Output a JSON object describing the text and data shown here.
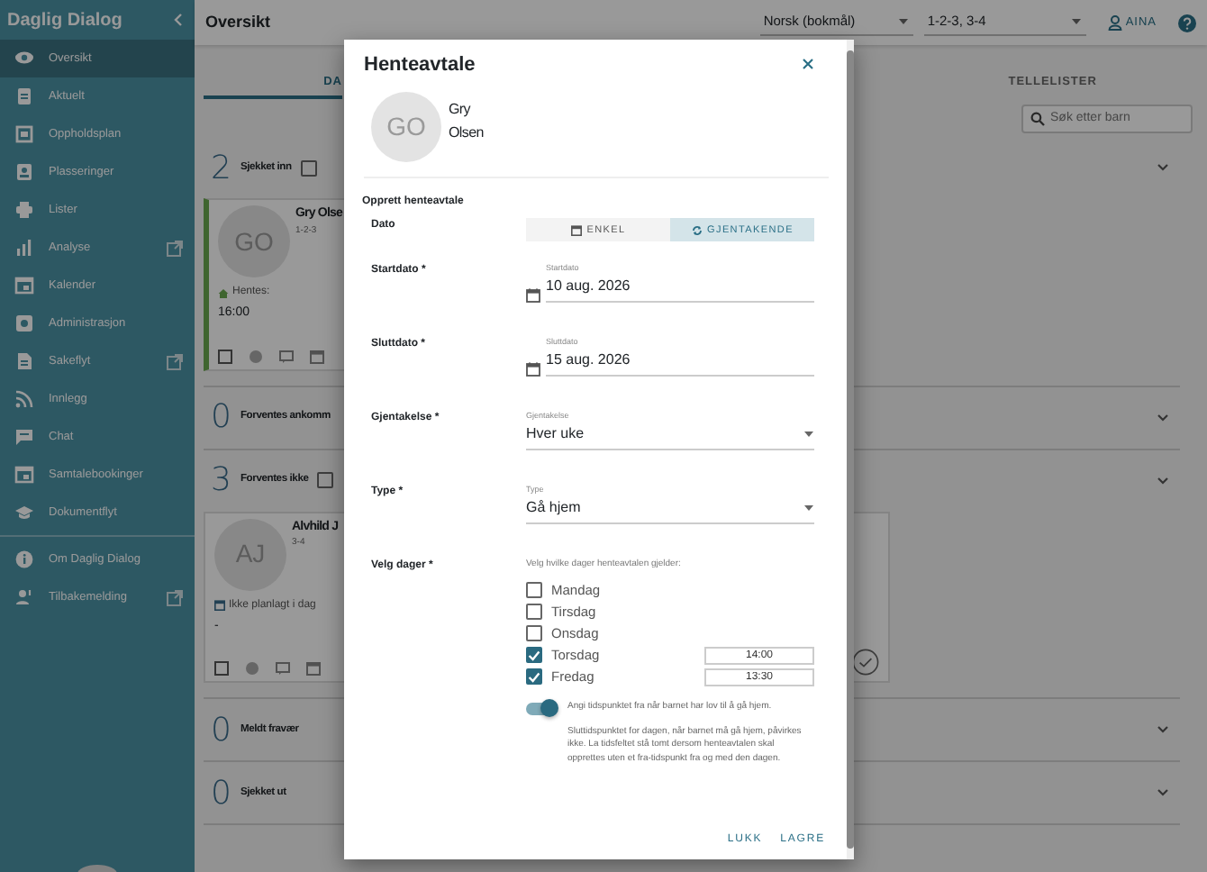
{
  "sidebar": {
    "title": "Daglig Dialog",
    "items": [
      {
        "label": "Oversikt",
        "selected": true,
        "external": false
      },
      {
        "label": "Aktuelt",
        "selected": false,
        "external": false
      },
      {
        "label": "Oppholdsplan",
        "selected": false,
        "external": false
      },
      {
        "label": "Plasseringer",
        "selected": false,
        "external": false
      },
      {
        "label": "Lister",
        "selected": false,
        "external": false
      },
      {
        "label": "Analyse",
        "selected": false,
        "external": true
      },
      {
        "label": "Kalender",
        "selected": false,
        "external": false
      },
      {
        "label": "Administrasjon",
        "selected": false,
        "external": false
      },
      {
        "label": "Sakeflyt",
        "selected": false,
        "external": true
      },
      {
        "label": "Innlegg",
        "selected": false,
        "external": false
      },
      {
        "label": "Chat",
        "selected": false,
        "external": false
      },
      {
        "label": "Samtalebookinger",
        "selected": false,
        "external": false
      },
      {
        "label": "Dokumentflyt",
        "selected": false,
        "external": false
      }
    ],
    "footer_items": [
      {
        "label": "Om Daglig Dialog",
        "selected": false,
        "external": false
      },
      {
        "label": "Tilbakemelding",
        "selected": false,
        "external": true
      }
    ]
  },
  "header": {
    "title": "Oversikt",
    "language": "Norsk (bokmål)",
    "groups": "1-2-3, 3-4",
    "user": "AINA"
  },
  "tabs": [
    {
      "label": "DA",
      "selected": true
    },
    {
      "label": "TELLELISTER",
      "selected": false
    }
  ],
  "search": {
    "placeholder": "Søk etter barn"
  },
  "sections": [
    {
      "count": "2",
      "title": "Sjekket inn",
      "checkbox": {
        "checked": false
      },
      "children": [
        {
          "initials": "GO",
          "name": "Gry Olse",
          "groups": "1-2-3",
          "kind": "pickup",
          "status": "Hentes:",
          "time": "16:00",
          "checked_in": true,
          "check_button": false
        }
      ]
    },
    {
      "count": "0",
      "title": "Forventes ankomm"
    },
    {
      "count": "3",
      "title": "Forventes ikke",
      "checkbox": {
        "checked": false
      },
      "children": [
        {
          "initials": "AJ",
          "name": "Alvhild J",
          "groups": "3-4",
          "kind": "not_planned",
          "status": "Ikke planlagt i dag",
          "time": "-",
          "checked_in": false,
          "check_button": true
        }
      ]
    },
    {
      "count": "0",
      "title": "Meldt fravær"
    },
    {
      "count": "0",
      "title": "Sjekket ut"
    }
  ],
  "dialog": {
    "title": "Henteavtale",
    "child": {
      "initials": "GO",
      "name": "Gry Olsen"
    },
    "section": "Opprett henteavtale",
    "date_mode": {
      "label": "Dato",
      "options": [
        {
          "label": "ENKEL",
          "kind": "single",
          "selected": false
        },
        {
          "label": "GJENTAKENDE",
          "kind": "recurring",
          "selected": true
        }
      ]
    },
    "fields": [
      {
        "label": "Startdato *",
        "kind": "date",
        "caption": "Startdato",
        "value": "10 aug. 2026"
      },
      {
        "label": "Sluttdato *",
        "kind": "date",
        "caption": "Sluttdato",
        "value": "15 aug. 2026"
      },
      {
        "label": "Gjentakelse *",
        "kind": "select",
        "caption": "Gjentakelse",
        "value": "Hver uke"
      },
      {
        "label": "Type *",
        "kind": "select",
        "caption": "Type",
        "value": "Gå hjem"
      }
    ],
    "days": {
      "label": "Velg dager *",
      "hint": "Velg hvilke dager henteavtalen gjelder:",
      "items": [
        {
          "label": "Mandag",
          "checked": false
        },
        {
          "label": "Tirsdag",
          "checked": false
        },
        {
          "label": "Onsdag",
          "checked": false
        },
        {
          "label": "Torsdag",
          "checked": true,
          "time": "14:00"
        },
        {
          "label": "Fredag",
          "checked": true,
          "time": "13:30"
        }
      ]
    },
    "time_toggle": {
      "on": true,
      "label": "Angi tidspunktet fra når barnet har lov til å gå hjem.",
      "note": "Sluttidspunktet for dagen, når barnet må gå hjem, påvirkes ikke. La tidsfeltet stå tomt dersom henteavtalen skal opprettes uten et fra-tidspunkt fra og med den dagen."
    },
    "buttons": [
      "LUKK",
      "LAGRE"
    ]
  }
}
